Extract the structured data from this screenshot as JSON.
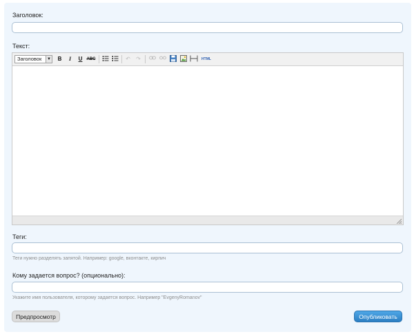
{
  "title_field": {
    "label": "Заголовок:",
    "value": ""
  },
  "text_field": {
    "label": "Текст:",
    "value": ""
  },
  "toolbar": {
    "format_select": "Заголовок",
    "bold": "B",
    "italic": "I",
    "underline": "U",
    "strike": "ABC",
    "html": "HTML",
    "icons": [
      "bold-icon",
      "italic-icon",
      "underline-icon",
      "strikethrough-icon",
      "bullet-list-icon",
      "numbered-list-icon",
      "undo-icon",
      "redo-icon",
      "link-icon",
      "unlink-icon",
      "save-icon",
      "image-icon",
      "horizontal-rule-icon",
      "html-icon"
    ]
  },
  "tags_field": {
    "label": "Теги:",
    "value": "",
    "hint": "Теги нужно разделять запятой. Например: google, вконтакте, кирпич"
  },
  "recipient_field": {
    "label": "Кому задается вопрос? (опционально):",
    "value": "",
    "hint": "Укажите имя пользователя, которому задается вопрос. Например \"EvgenyRomanov\""
  },
  "buttons": {
    "preview": "Предпросмотр",
    "publish": "Опубликовать"
  },
  "colors": {
    "panel": "#eff6fd",
    "input_border": "#a9bfd3",
    "publish_button": "#3a8fd3"
  }
}
